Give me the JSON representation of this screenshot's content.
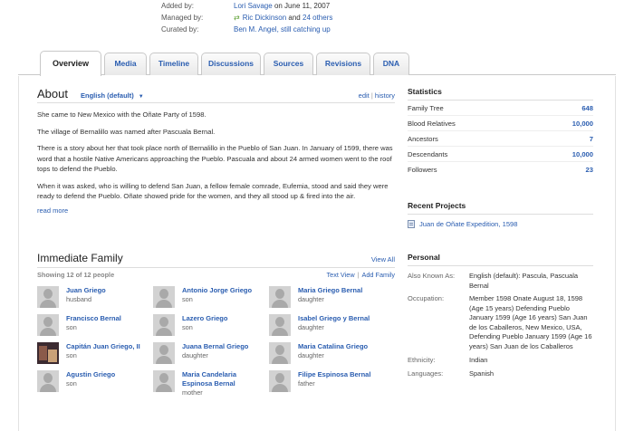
{
  "meta": {
    "added_label": "Added by:",
    "added_user": "Lori Savage",
    "added_date": "on June 11, 2007",
    "managed_label": "Managed by:",
    "managed_user": "Ric Dickinson",
    "managed_and": "and",
    "managed_others": "24 others",
    "curated_label": "Curated by:",
    "curated_user": "Ben M. Angel, still catching up"
  },
  "tabs": [
    "Overview",
    "Media",
    "Timeline",
    "Discussions",
    "Sources",
    "Revisions",
    "DNA"
  ],
  "active_tab": "Overview",
  "about": {
    "title": "About",
    "language": "English (default)",
    "edit": "edit",
    "sep": "|",
    "history": "history",
    "paragraphs": [
      "She came to New Mexico with the Oñate Party of 1598.",
      "The village of Bernalillo was named after Pascuala Bernal.",
      "There is a story about her that took place north of Bernalillo in the Pueblo of San Juan. In January of 1599, there was word that a hostile Native Americans approaching the Pueblo. Pascuala and about 24 armed women went to the roof tops to defend the Pueblo.",
      "When it was asked, who is willing to defend San Juan, a fellow female comrade, Eufemia, stood and said they were ready to defend the Pueblo. Oñate showed pride for the women, and they all stood up & fired into the air."
    ],
    "read_more": "read more"
  },
  "family": {
    "title": "Immediate Family",
    "view_all": "View All",
    "count": "Showing 12 of 12 people",
    "text_view": "Text View",
    "sep": "|",
    "add_family": "Add Family",
    "members": [
      {
        "name": "Juan Griego",
        "relation": "husband",
        "photo": false
      },
      {
        "name": "Antonio Jorge Griego",
        "relation": "son",
        "photo": false
      },
      {
        "name": "Maria Griego Bernal",
        "relation": "daughter",
        "photo": false
      },
      {
        "name": "Francisco Bernal",
        "relation": "son",
        "photo": false
      },
      {
        "name": "Lazero Griego",
        "relation": "son",
        "photo": false
      },
      {
        "name": "Isabel Griego y Bernal",
        "relation": "daughter",
        "photo": false
      },
      {
        "name": "Capitán Juan Griego, II",
        "relation": "son",
        "photo": true
      },
      {
        "name": "Juana Bernal Griego",
        "relation": "daughter",
        "photo": false
      },
      {
        "name": "Maria Catalina Griego",
        "relation": "daughter",
        "photo": false
      },
      {
        "name": "Agustin Griego",
        "relation": "son",
        "photo": false
      },
      {
        "name": "Maria Candelaria Espinosa Bernal",
        "relation": "mother",
        "photo": false
      },
      {
        "name": "Filipe Espinosa Bernal",
        "relation": "father",
        "photo": false
      }
    ]
  },
  "stats": {
    "title": "Statistics",
    "rows": [
      {
        "label": "Family Tree",
        "value": "648"
      },
      {
        "label": "Blood Relatives",
        "value": "10,000"
      },
      {
        "label": "Ancestors",
        "value": "7"
      },
      {
        "label": "Descendants",
        "value": "10,000"
      },
      {
        "label": "Followers",
        "value": "23"
      }
    ]
  },
  "projects": {
    "title": "Recent Projects",
    "item": "Juan de Oñate Expedition, 1598"
  },
  "personal": {
    "title": "Personal",
    "aka_label": "Also Known As:",
    "aka_value": "English (default): Pascula, Pascuala Bernal",
    "occ_label": "Occupation:",
    "occ_value": "Member 1598 Onate August 18, 1598 (Age 15 years) Defending Pueblo January 1599 (Age 16 years) San Juan de los Caballeros, New Mexico, USA, Defending Pueblo January 1599 (Age 16 years) San Juan de los Caballeros",
    "eth_label": "Ethnicity:",
    "eth_value": "Indian",
    "lang_label": "Languages:",
    "lang_value": "Spanish"
  },
  "colors": {
    "link": "#2a5db0",
    "sync_icon": "#5a9e2f"
  }
}
